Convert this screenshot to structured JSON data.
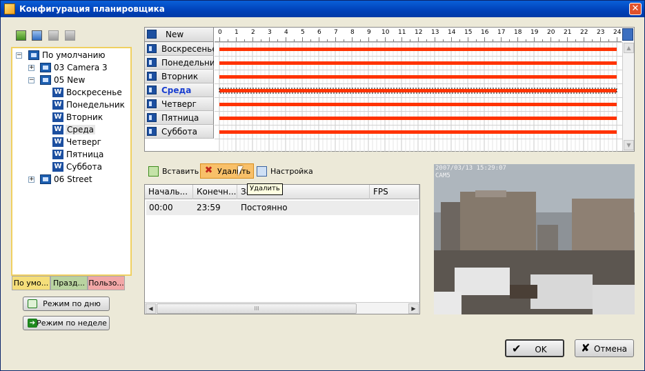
{
  "window": {
    "title": "Конфигурация планировщика",
    "close_glyph": "✕"
  },
  "left_toolbar": {
    "icons": [
      "import-icon",
      "copy-icon",
      "paste-icon",
      "export-icon"
    ]
  },
  "tree": {
    "root": "По умолчанию",
    "cam1": "03 Camera 3",
    "cam2": "05 New",
    "cam3": "06 Street",
    "days": [
      "Воскресенье",
      "Понедельник",
      "Вторник",
      "Среда",
      "Четверг",
      "Пятница",
      "Суббота"
    ],
    "selected_day": "Среда"
  },
  "left_tabs": [
    {
      "label": "По умо...",
      "color": "#f5de7a"
    },
    {
      "label": "Празд...",
      "color": "#b9d3a0"
    },
    {
      "label": "Пользо...",
      "color": "#f2a7a7"
    }
  ],
  "mode_buttons": {
    "day": "Режим по дню",
    "week": "Режим по неделе"
  },
  "schedule": {
    "header": "New",
    "hours": [
      "0",
      "1",
      "2",
      "3",
      "4",
      "5",
      "6",
      "7",
      "8",
      "9",
      "10",
      "11",
      "12",
      "13",
      "14",
      "15",
      "16",
      "17",
      "18",
      "19",
      "20",
      "21",
      "22",
      "23",
      "24"
    ],
    "rows": [
      "Воскресенье",
      "Понедельник",
      "Вторник",
      "Среда",
      "Четверг",
      "Пятница",
      "Суббота"
    ],
    "selected_row": "Среда",
    "bar_color": "#ff3300",
    "scroll_up": "▲",
    "scroll_down": "▼"
  },
  "actions": {
    "insert": "Вставить",
    "delete": "Удалить",
    "settings": "Настройка"
  },
  "tooltip": "Удалить",
  "table": {
    "columns": [
      "Началь...",
      "Конечн...",
      "За",
      "FPS"
    ],
    "rows": [
      {
        "start": "00:00",
        "end": "23:59",
        "type": "Постоянно"
      }
    ],
    "scroll_left": "◀",
    "scroll_right": "▶",
    "scroll_grip": "III"
  },
  "camera": {
    "timestamp": "2007/03/13 15:29:07",
    "name": "CAM5"
  },
  "buttons": {
    "ok": "OK",
    "cancel": "Отмена",
    "ok_glyph": "✔",
    "cancel_glyph": "✘"
  }
}
